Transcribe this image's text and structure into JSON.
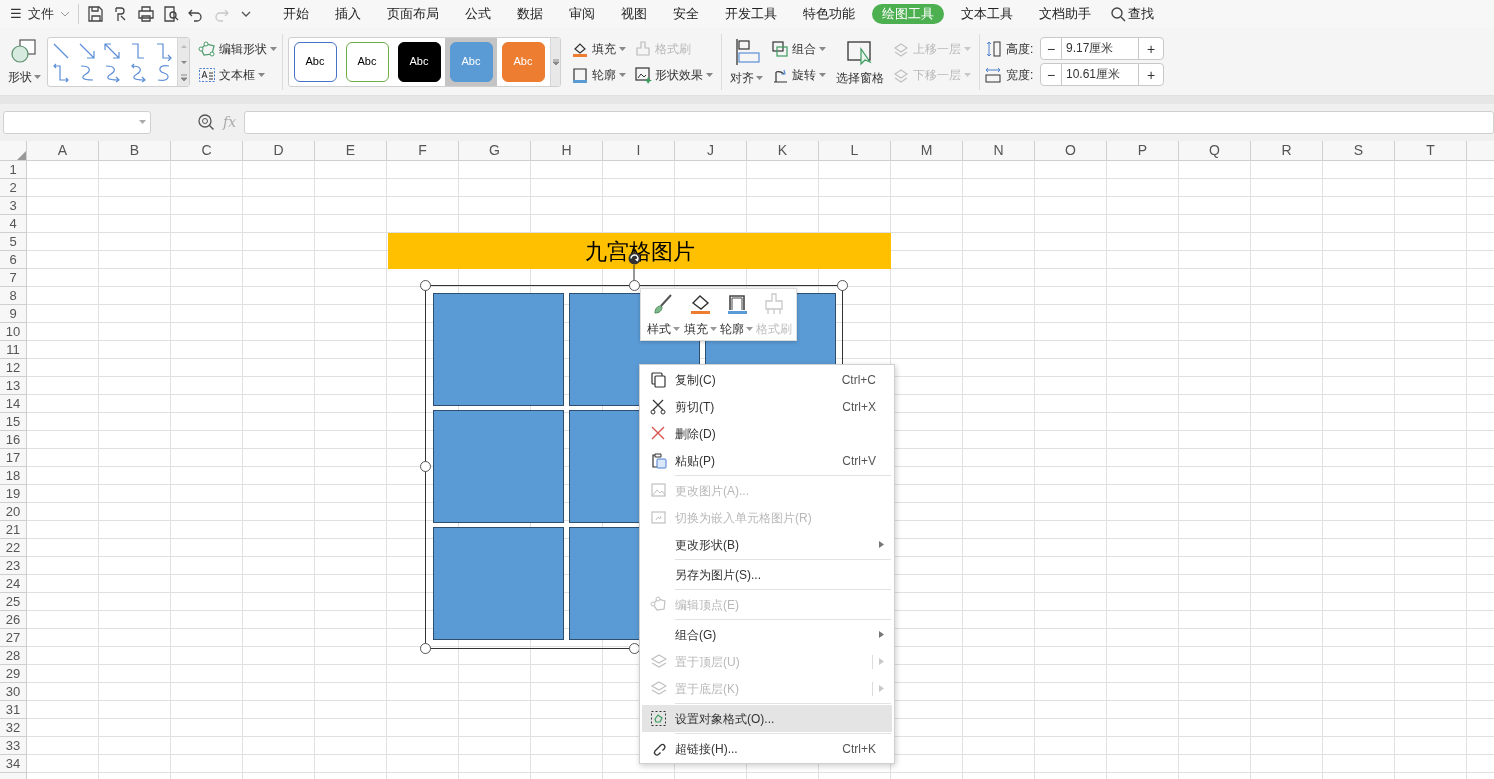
{
  "menu_bar": {
    "menu_icon": "☰",
    "file": "文件",
    "tabs": [
      {
        "label": "开始",
        "selected": false
      },
      {
        "label": "插入",
        "selected": false
      },
      {
        "label": "页面布局",
        "selected": false
      },
      {
        "label": "公式",
        "selected": false
      },
      {
        "label": "数据",
        "selected": false
      },
      {
        "label": "审阅",
        "selected": false
      },
      {
        "label": "视图",
        "selected": false
      },
      {
        "label": "安全",
        "selected": false
      },
      {
        "label": "开发工具",
        "selected": false
      },
      {
        "label": "特色功能",
        "selected": false
      },
      {
        "label": "绘图工具",
        "selected": true
      },
      {
        "label": "文本工具",
        "selected": false
      },
      {
        "label": "文档助手",
        "selected": false
      }
    ],
    "search": "查找"
  },
  "ribbon": {
    "shape": "形状",
    "edit_shape": "编辑形状",
    "text_box": "文本框",
    "styles": [
      {
        "label": "Abc",
        "kind": "outline",
        "color": "#4472c4",
        "selected": false
      },
      {
        "label": "Abc",
        "kind": "outline",
        "color": "#70ad47",
        "selected": false
      },
      {
        "label": "Abc",
        "kind": "filled",
        "color": "#000000",
        "selected": false
      },
      {
        "label": "Abc",
        "kind": "filled",
        "color": "#5b9bd5",
        "selected": true
      },
      {
        "label": "Abc",
        "kind": "filled",
        "color": "#ed7d31",
        "selected": false
      }
    ],
    "fill": {
      "label": "填充",
      "disabled": false
    },
    "format_painter": {
      "label": "格式刷",
      "disabled": true
    },
    "outline": {
      "label": "轮廓",
      "disabled": false
    },
    "shape_effects": {
      "label": "形状效果",
      "disabled": false
    },
    "align": "对齐",
    "group": "组合",
    "rotate": "旋转",
    "selection_pane": "选择窗格",
    "bring_forward": {
      "label": "上移一层",
      "disabled": true
    },
    "send_backward": {
      "label": "下移一层",
      "disabled": true
    },
    "height": {
      "label": "高度:",
      "value": "9.17厘米",
      "minus": "−",
      "plus": "+"
    },
    "width": {
      "label": "宽度:",
      "value": "10.61厘米",
      "minus": "−",
      "plus": "+"
    }
  },
  "formula_bar": {
    "fx": "fx"
  },
  "sheet": {
    "columns": [
      "A",
      "B",
      "C",
      "D",
      "E",
      "F",
      "G",
      "H",
      "I",
      "J",
      "K",
      "L",
      "M",
      "N",
      "O",
      "P",
      "Q",
      "R",
      "S",
      "T"
    ],
    "rows": [
      "1",
      "2",
      "3",
      "4",
      "5",
      "6",
      "7",
      "8",
      "9",
      "10",
      "11",
      "12",
      "13",
      "14",
      "15",
      "16",
      "17",
      "18",
      "19",
      "20",
      "21",
      "22",
      "23",
      "24",
      "25",
      "26",
      "27",
      "28",
      "29",
      "30",
      "31",
      "32",
      "33",
      "34"
    ],
    "banner": "九宫格图片"
  },
  "float_toolbar": [
    {
      "label": "样式",
      "disabled": false
    },
    {
      "label": "填充",
      "disabled": false
    },
    {
      "label": "轮廓",
      "disabled": false
    },
    {
      "label": "格式刷",
      "disabled": true
    }
  ],
  "context_menu": [
    {
      "kind": "item",
      "label": "复制(C)",
      "shortcut": "Ctrl+C",
      "disabled": false,
      "submenu": false,
      "selected": false
    },
    {
      "kind": "item",
      "label": "剪切(T)",
      "shortcut": "Ctrl+X",
      "disabled": false,
      "submenu": false,
      "selected": false
    },
    {
      "kind": "item",
      "label": "删除(D)",
      "disabled": false,
      "submenu": false,
      "selected": false
    },
    {
      "kind": "item",
      "label": "粘贴(P)",
      "shortcut": "Ctrl+V",
      "disabled": false,
      "submenu": false,
      "selected": false
    },
    {
      "kind": "separator"
    },
    {
      "kind": "item",
      "label": "更改图片(A)...",
      "disabled": true,
      "submenu": false,
      "selected": false
    },
    {
      "kind": "item",
      "label": "切换为嵌入单元格图片(R)",
      "disabled": true,
      "submenu": false,
      "selected": false
    },
    {
      "kind": "item",
      "label": "更改形状(B)",
      "disabled": false,
      "submenu": true,
      "selected": false
    },
    {
      "kind": "separator"
    },
    {
      "kind": "item",
      "label": "另存为图片(S)...",
      "disabled": false,
      "submenu": false,
      "selected": false
    },
    {
      "kind": "separator"
    },
    {
      "kind": "item",
      "label": "编辑顶点(E)",
      "disabled": true,
      "submenu": false,
      "selected": false
    },
    {
      "kind": "separator"
    },
    {
      "kind": "item",
      "label": "组合(G)",
      "disabled": false,
      "submenu": true,
      "selected": false
    },
    {
      "kind": "item",
      "label": "置于顶层(U)",
      "disabled": true,
      "submenu": true,
      "selected": false
    },
    {
      "kind": "item",
      "label": "置于底层(K)",
      "disabled": true,
      "submenu": true,
      "selected": false
    },
    {
      "kind": "separator"
    },
    {
      "kind": "item",
      "label": "设置对象格式(O)...",
      "disabled": false,
      "submenu": false,
      "selected": true
    },
    {
      "kind": "separator"
    },
    {
      "kind": "item",
      "label": "超链接(H)...",
      "shortcut": "Ctrl+K",
      "disabled": false,
      "submenu": false,
      "selected": false
    }
  ]
}
